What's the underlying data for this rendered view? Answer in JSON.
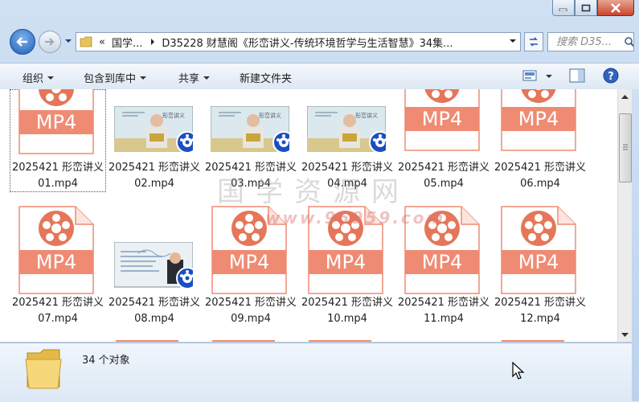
{
  "window": {
    "caption_buttons": [
      "minimize",
      "maximize",
      "close"
    ]
  },
  "nav": {
    "breadcrumb_overflow": "«",
    "breadcrumb_parent": "国学...",
    "breadcrumb_current": "D35228 财慧阁《形峦讲义-传统环境哲学与生活智慧》34集...",
    "search_placeholder": "搜索 D35..."
  },
  "toolbar": {
    "organize_label": "组织",
    "include_library_label": "包含到库中",
    "share_label": "共享",
    "new_folder_label": "新建文件夹"
  },
  "files": [
    {
      "line1": "2025421 形峦讲义",
      "line2": "01.mp4",
      "kind": "icon",
      "selected": true
    },
    {
      "line1": "2025421 形峦讲义",
      "line2": "02.mp4",
      "kind": "video"
    },
    {
      "line1": "2025421 形峦讲义",
      "line2": "03.mp4",
      "kind": "video"
    },
    {
      "line1": "2025421 形峦讲义",
      "line2": "04.mp4",
      "kind": "video"
    },
    {
      "line1": "2025421 形峦讲义",
      "line2": "05.mp4",
      "kind": "icon"
    },
    {
      "line1": "2025421 形峦讲义",
      "line2": "06.mp4",
      "kind": "icon"
    },
    {
      "line1": "2025421 形峦讲义",
      "line2": "07.mp4",
      "kind": "icon"
    },
    {
      "line1": "2025421 形峦讲义",
      "line2": "08.mp4",
      "kind": "video2"
    },
    {
      "line1": "2025421 形峦讲义",
      "line2": "09.mp4",
      "kind": "icon"
    },
    {
      "line1": "2025421 形峦讲义",
      "line2": "10.mp4",
      "kind": "icon"
    },
    {
      "line1": "2025421 形峦讲义",
      "line2": "11.mp4",
      "kind": "icon"
    },
    {
      "line1": "2025421 形峦讲义",
      "line2": "12.mp4",
      "kind": "icon"
    }
  ],
  "mp4_badge_text": "MP4",
  "thumb_title_text": "形峦讲义",
  "watermark": {
    "main": "国学资源网",
    "url": "www.95959.com"
  },
  "status": {
    "object_count": "34 个对象"
  },
  "colors": {
    "mp4_accent": "#ef8b73",
    "mp4_accent_dark": "#e57659",
    "player_badge": "#1a4fc4"
  }
}
